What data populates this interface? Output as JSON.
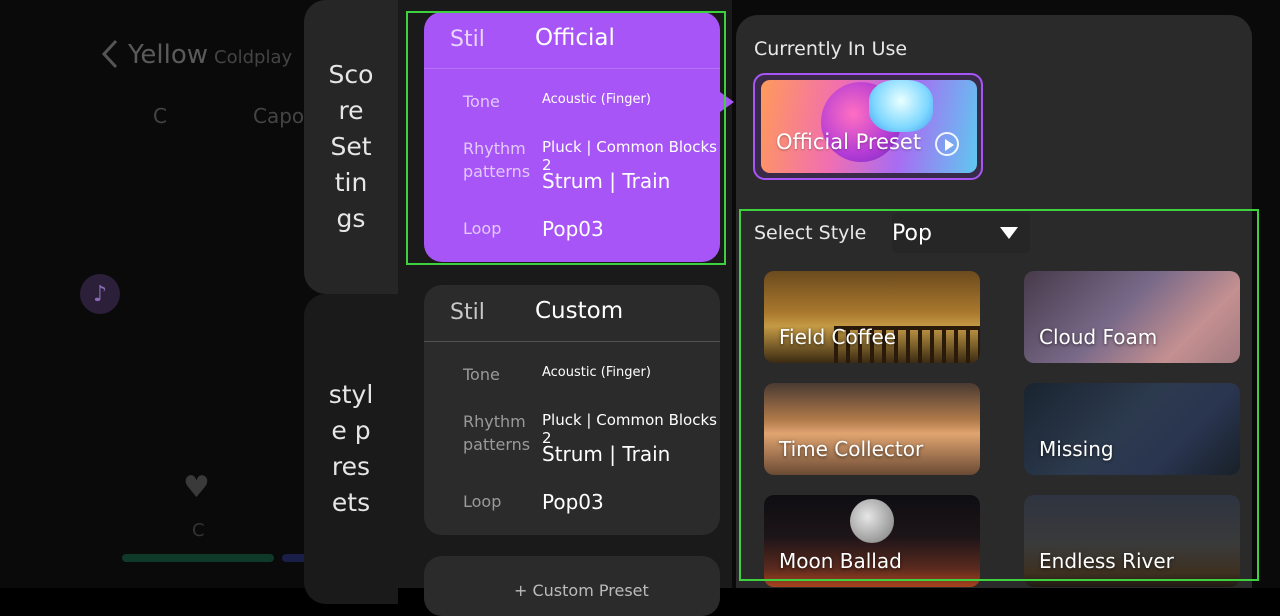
{
  "background": {
    "song_title": "Yellow",
    "artist": "Coldplay",
    "chord": "C",
    "capo": "Capo",
    "small_chord": "C"
  },
  "tabs": {
    "score_settings": "Score Settings",
    "style_presets": "style presets"
  },
  "cards": [
    {
      "stil_label": "Stil",
      "stil_value": "Official",
      "tone_label": "Tone",
      "tone_value": "Acoustic (Finger)",
      "rhythm_label": "Rhythm patterns",
      "rhythm_value_1": "Pluck | Common Blocks 2",
      "rhythm_value_2": "Strum | Train",
      "loop_label": "Loop",
      "loop_value": "Pop03"
    },
    {
      "stil_label": "Stil",
      "stil_value": "Custom",
      "tone_label": "Tone",
      "tone_value": "Acoustic (Finger)",
      "rhythm_label": "Rhythm patterns",
      "rhythm_value_1": "Pluck | Common Blocks 2",
      "rhythm_value_2": "Strum | Train",
      "loop_label": "Loop",
      "loop_value": "Pop03"
    }
  ],
  "bottom_stub": "+ Custom Preset",
  "current": {
    "label": "Currently In Use",
    "preset_title": "Official Preset"
  },
  "select": {
    "label": "Select Style",
    "value": "Pop"
  },
  "styles": [
    "Field Coffee",
    "Cloud Foam",
    "Time Collector",
    "Missing",
    "Moon Ballad",
    "Endless River"
  ],
  "colors": {
    "accent": "#a855f7",
    "highlight": "#3ed13e"
  }
}
